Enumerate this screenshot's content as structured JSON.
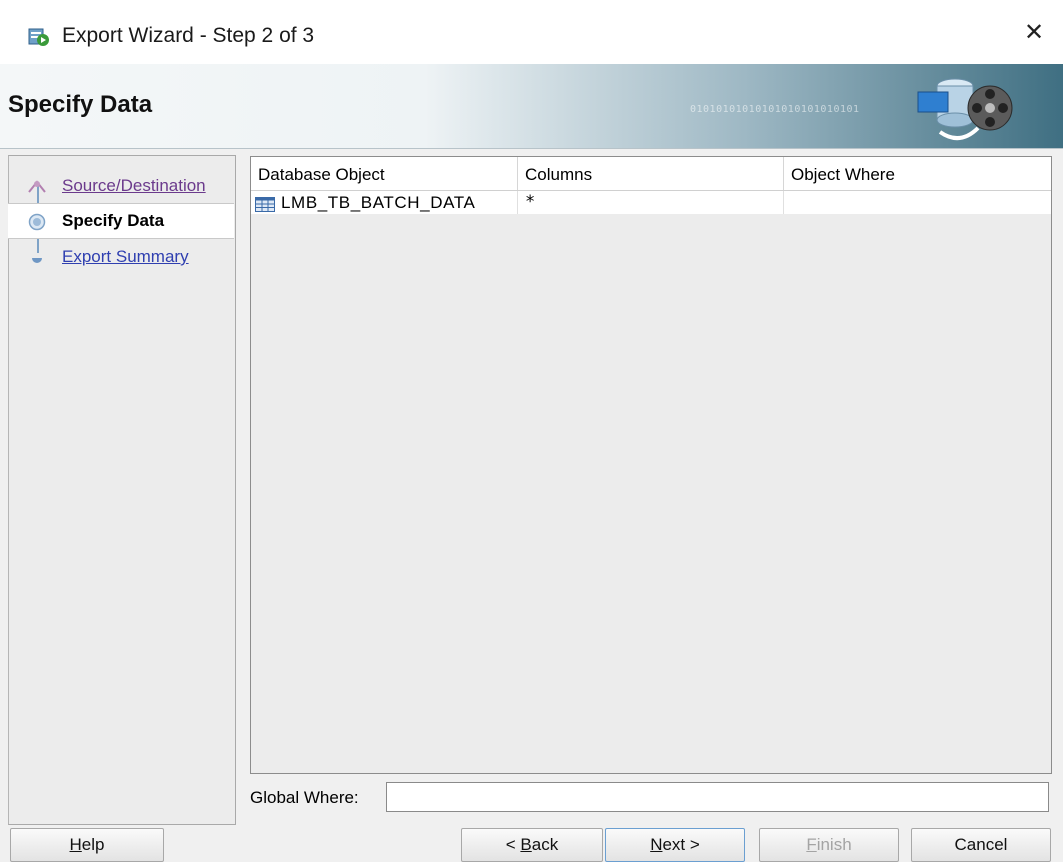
{
  "window": {
    "title": "Export Wizard - Step 2 of 3",
    "close_glyph": "✕",
    "icon": "export-wizard-icon"
  },
  "banner": {
    "heading": "Specify Data",
    "binary_text": "01010101010101010101010101"
  },
  "nav": {
    "items": [
      {
        "label": "Source/Destination",
        "state": "visited"
      },
      {
        "label": "Specify Data",
        "state": "current"
      },
      {
        "label": "Export Summary",
        "state": "link"
      }
    ]
  },
  "table": {
    "columns": [
      "Database Object",
      "Columns",
      "Object Where"
    ],
    "rows": [
      {
        "object": "LMB_TB_BATCH_DATA",
        "columns": "*",
        "where": ""
      }
    ]
  },
  "global_where": {
    "label": "Global Where:",
    "value": ""
  },
  "buttons": {
    "help": {
      "label": "Help",
      "mnemonic": "H"
    },
    "back": {
      "label": "< Back",
      "mnemonic": "B"
    },
    "next": {
      "label": "Next >",
      "mnemonic": "N"
    },
    "finish": {
      "label": "Finish",
      "mnemonic": "F"
    },
    "cancel": {
      "label": "Cancel"
    }
  }
}
